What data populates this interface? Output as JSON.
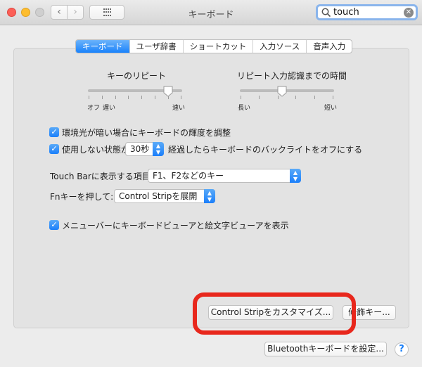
{
  "window": {
    "title": "キーボード"
  },
  "search": {
    "value": "touch"
  },
  "tabs": [
    "キーボード",
    "ユーザ辞書",
    "ショートカット",
    "入力ソース",
    "音声入力"
  ],
  "key_repeat": {
    "label": "キーのリピート",
    "min_label": "オフ",
    "slow_label": "遅い",
    "max_label": "速い",
    "level": 0.85
  },
  "repeat_delay": {
    "label": "リピート入力認識までの時間",
    "min_label": "長い",
    "max_label": "短い",
    "level": 0.45
  },
  "options": {
    "ambient_light": {
      "label": "環境光が暗い場合にキーボードの輝度を調整",
      "checked": true
    },
    "backlight_off": {
      "label_before": "使用しない状態が",
      "value": "30秒",
      "label_after": "経過したらキーボードのバックライトをオフにする",
      "checked": true
    },
    "show_viewer": {
      "label": "メニューバーにキーボードビューアと絵文字ビューアを表示",
      "checked": true
    }
  },
  "touch_bar": {
    "label": "Touch Barに表示する項目:",
    "value": "F1、F2などのキー"
  },
  "fn_key": {
    "label": "Fnキーを押して:",
    "value": "Control Stripを展開"
  },
  "buttons": {
    "customize_strip": "Control Stripをカスタマイズ...",
    "modifier_keys": "修飾キー...",
    "bluetooth_setup": "Bluetoothキーボードを設定...",
    "help": "?"
  },
  "colors": {
    "accent": "#1a82fb",
    "annotation": "#e8271c"
  }
}
